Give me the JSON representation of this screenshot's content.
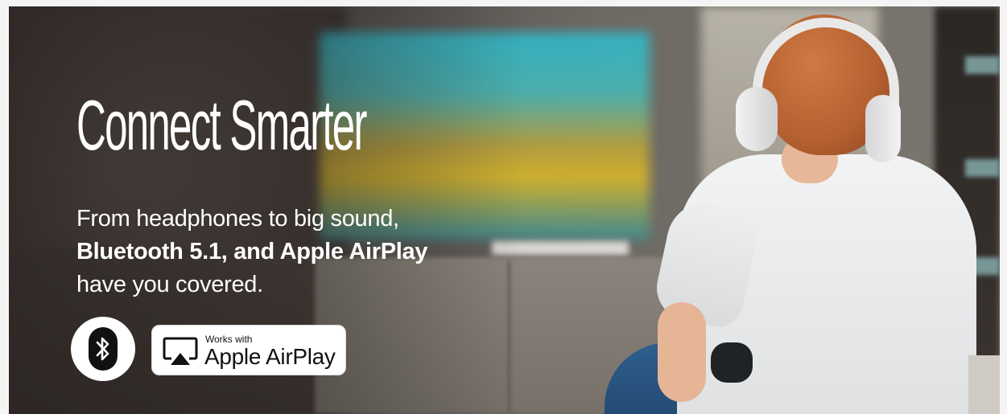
{
  "banner": {
    "headline": "Connect Smarter",
    "subcopy_line1": "From headphones to big sound,",
    "subcopy_line2": "Bluetooth 5.1, and Apple AirPlay",
    "subcopy_line3": "have you covered.",
    "badges": {
      "bluetooth_icon": "bluetooth-icon",
      "airplay_icon": "airplay-icon",
      "airplay_caption": "Works with",
      "airplay_label": "Apple AirPlay"
    },
    "colors": {
      "text": "#ffffff",
      "badge_bg": "#ffffff",
      "badge_fg": "#111111",
      "hair": "#b4602f",
      "shirt": "#e8e9ea",
      "tv_glow": "#2fb7c9"
    }
  }
}
